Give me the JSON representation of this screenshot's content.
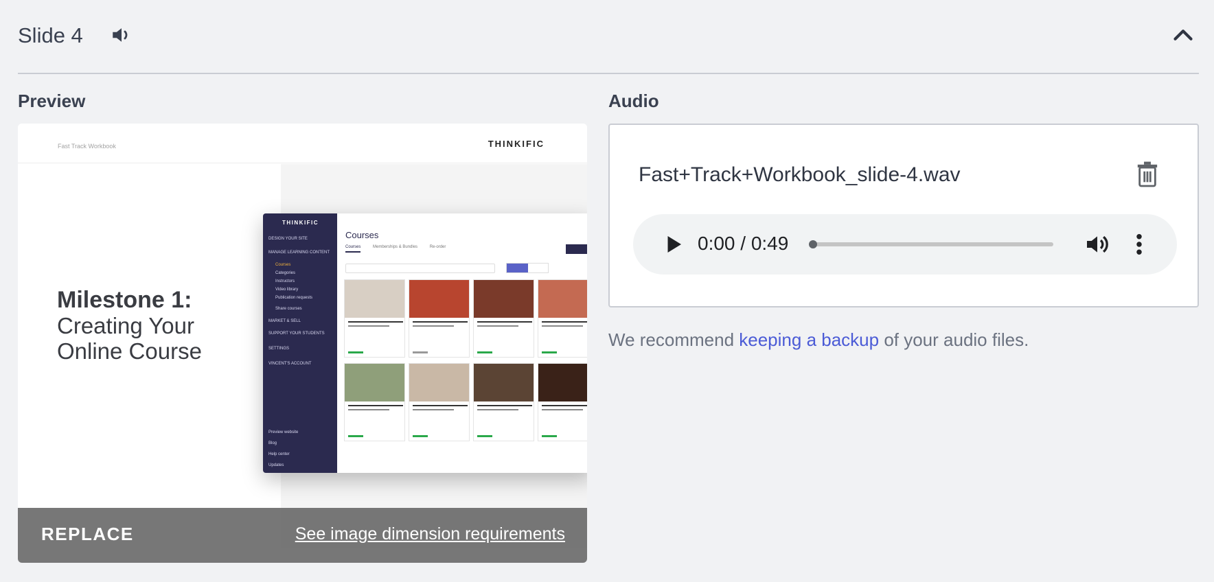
{
  "header": {
    "title": "Slide 4",
    "speaker_icon": "speaker-icon",
    "collapse_icon": "chevron-up-icon"
  },
  "labels": {
    "preview": "Preview",
    "audio": "Audio"
  },
  "preview": {
    "topbar_left": "Fast Track Workbook",
    "topbar_logo": "THINKIFIC",
    "heading_line1": "Milestone 1:",
    "heading_line2": "Creating Your",
    "heading_line3": "Online Course",
    "mini_app": {
      "logo": "THINKIFIC",
      "title": "Courses",
      "tabs": [
        "Courses",
        "Memberships & Bundles",
        "Re-order"
      ],
      "nav": [
        "DESIGN YOUR SITE",
        "MANAGE LEARNING CONTENT",
        "Courses",
        "Categories",
        "Instructors",
        "Video library",
        "Publication requests",
        "Share courses",
        "MARKET & SELL",
        "SUPPORT YOUR STUDENTS",
        "SETTINGS",
        "VINCENT'S ACCOUNT"
      ],
      "nav_bottom": [
        "Preview website",
        "Blog",
        "Help center",
        "Updates"
      ]
    },
    "replace_label": "REPLACE",
    "dimension_link": "See image dimension requirements"
  },
  "audio": {
    "filename": "Fast+Track+Workbook_slide-4.wav",
    "trash_icon": "trash-icon",
    "time": "0:00 / 0:49",
    "progress": 0,
    "play_icon": "play-icon",
    "volume_icon": "volume-icon",
    "more_icon": "more-vertical-icon"
  },
  "recommend": {
    "before": "We recommend ",
    "link": "keeping a backup",
    "after": " of your audio files."
  },
  "colors": {
    "accent_link": "#4b5bd6",
    "sidebar_dark": "#2b2a4f",
    "published_green": "#2aa84a"
  }
}
